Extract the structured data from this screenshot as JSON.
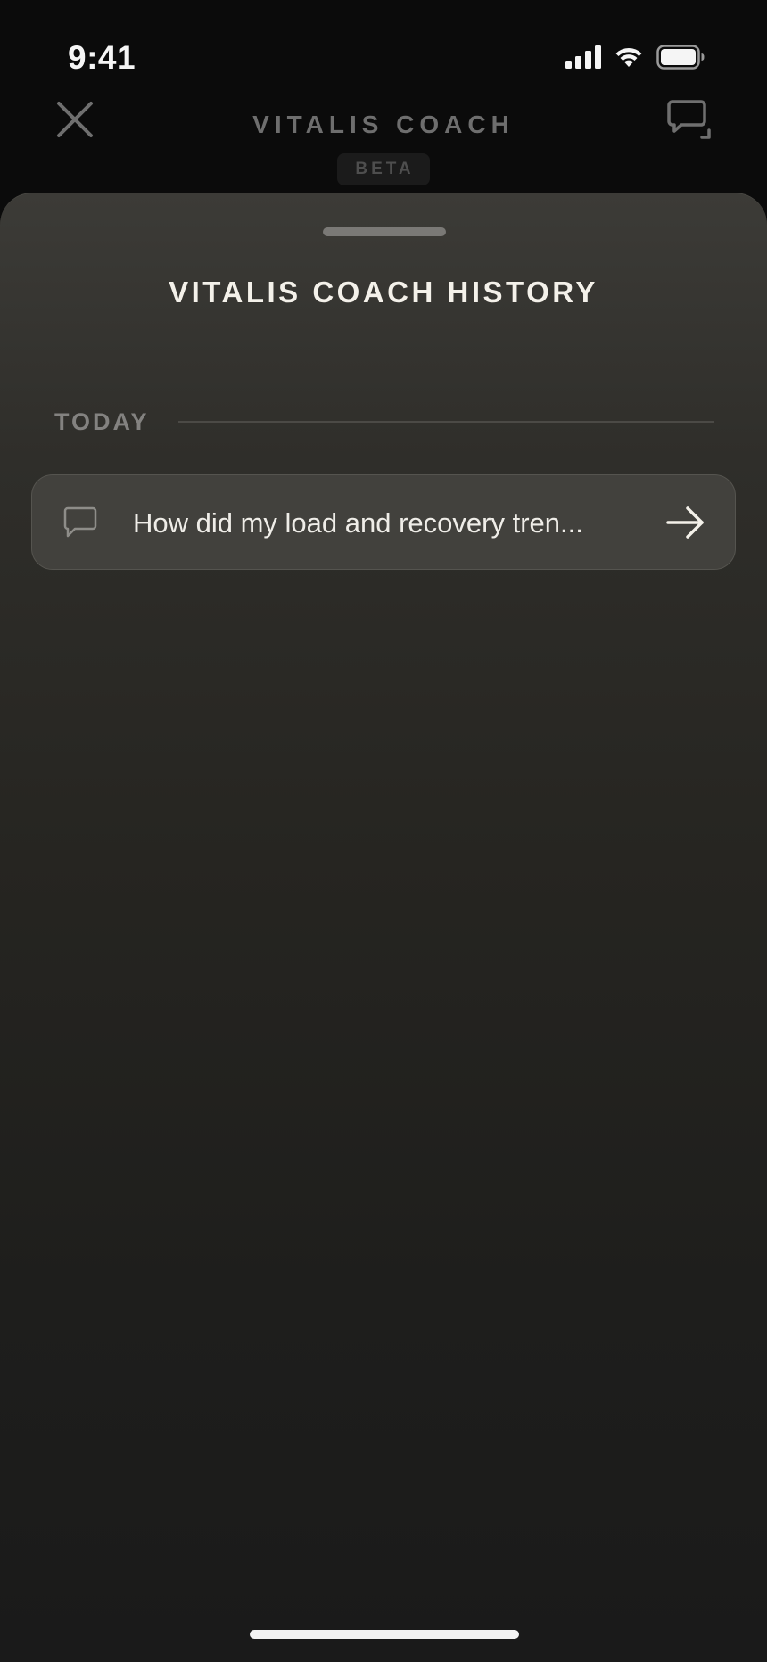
{
  "status_bar": {
    "time": "9:41",
    "icons": [
      "cellular-signal-icon",
      "wifi-icon",
      "battery-icon"
    ]
  },
  "header": {
    "title": "VITALIS COACH",
    "badge": "BETA",
    "left_icon": "close-icon",
    "right_icon": "new-chat-icon"
  },
  "sheet": {
    "title": "VITALIS COACH HISTORY",
    "sections": [
      {
        "label": "TODAY",
        "items": [
          {
            "text": "How did my load and recovery tren...",
            "icon": "chat-bubble-icon",
            "trailing_icon": "arrow-right-icon"
          }
        ]
      }
    ]
  },
  "colors": {
    "background": "#0b0b0b",
    "sheet_top": "#3c3b37",
    "sheet_bottom": "#1a1a1a",
    "item_background": "#42413d",
    "title_text": "#f4f1ea",
    "muted_text": "#838280"
  }
}
